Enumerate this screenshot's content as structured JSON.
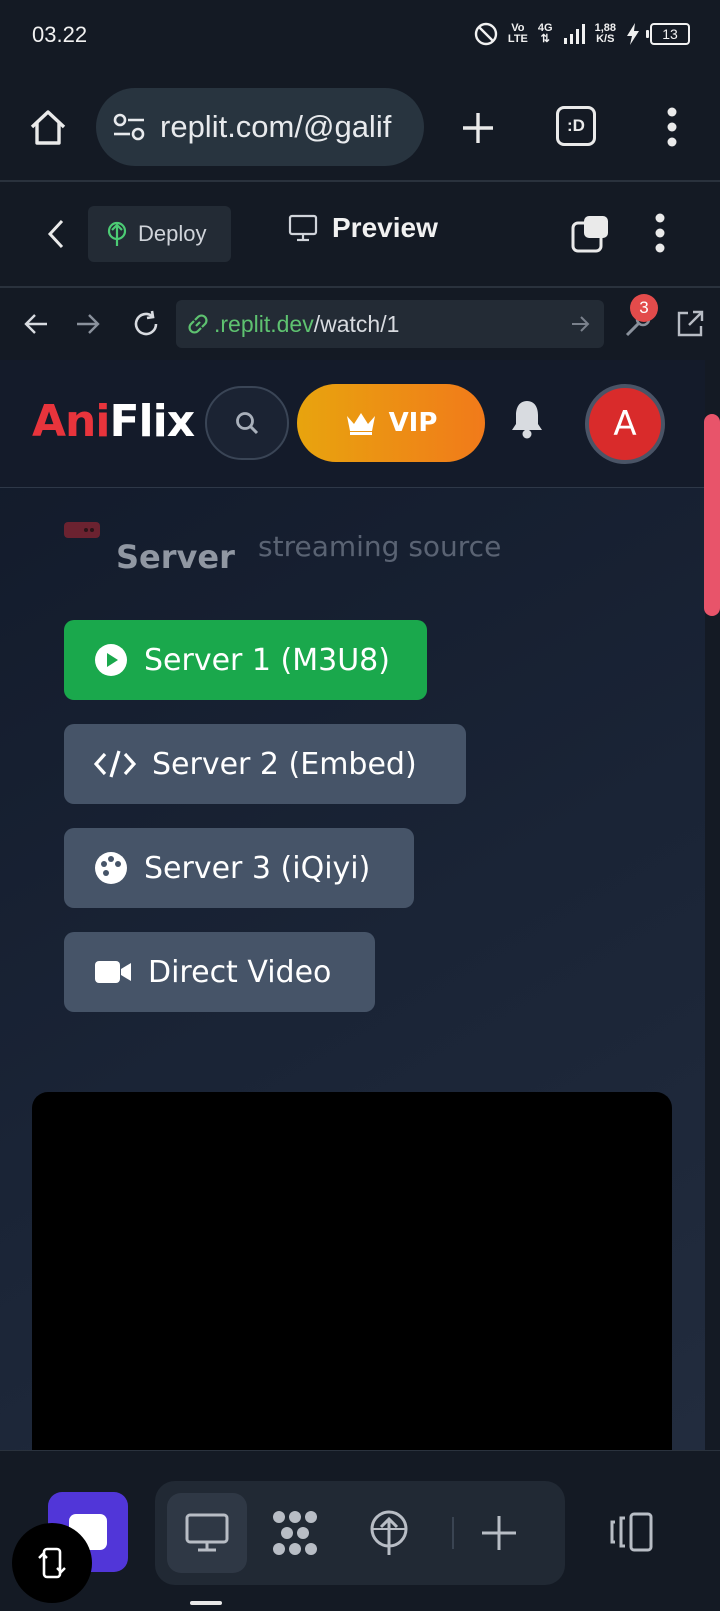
{
  "status_bar": {
    "time": "03.22",
    "network_line1": "Vo",
    "network_line2": "LTE",
    "signal_type": "4G",
    "speed_value": "1,88",
    "speed_unit": "K/S",
    "battery": "13"
  },
  "browser": {
    "url": "replit.com/@galif",
    "tab_switcher_label": ":D"
  },
  "replit": {
    "deploy_label": "Deploy",
    "preview_label": "Preview"
  },
  "webview": {
    "address_domain": ".replit.dev",
    "address_path": "/watch/1",
    "devtools_badge": "3"
  },
  "site": {
    "logo_part1": "Ani",
    "logo_part2": "Flix",
    "vip_label": "VIP",
    "avatar_initial": "A",
    "server_title": "Server",
    "server_subtitle": "streaming source",
    "servers": [
      {
        "label": "Server 1 (M3U8)",
        "icon": "play-circle-icon",
        "active": true
      },
      {
        "label": "Server 2 (Embed)",
        "icon": "code-icon",
        "active": false
      },
      {
        "label": "Server 3 (iQiyi)",
        "icon": "palette-icon",
        "active": false
      },
      {
        "label": "Direct Video",
        "icon": "video-camera-icon",
        "active": false
      }
    ]
  },
  "colors": {
    "accent_red": "#e8343c",
    "active_server": "#1aa84c",
    "vip_gradient_start": "#e8a40e",
    "vip_gradient_end": "#f17a1a",
    "scroll_thumb": "#e8546a"
  }
}
